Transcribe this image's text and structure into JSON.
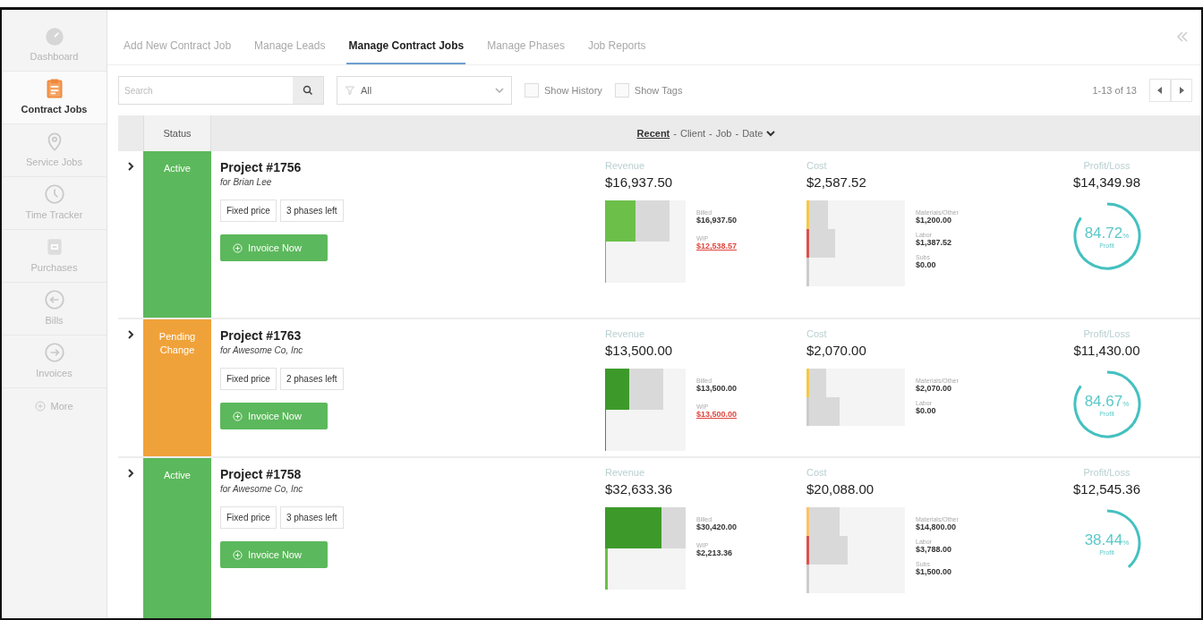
{
  "sidebar": {
    "items": [
      {
        "label": "Dashboard",
        "selected": false
      },
      {
        "label": "Contract Jobs",
        "selected": true
      },
      {
        "label": "Service Jobs",
        "selected": false
      },
      {
        "label": "Time Tracker",
        "selected": false
      },
      {
        "label": "Purchases",
        "selected": false
      },
      {
        "label": "Bills",
        "selected": false
      },
      {
        "label": "Invoices",
        "selected": false
      }
    ],
    "more": "More"
  },
  "tabs": [
    {
      "label": "Add New Contract Job",
      "selected": false
    },
    {
      "label": "Manage Leads",
      "selected": false
    },
    {
      "label": "Manage Contract Jobs",
      "selected": true
    },
    {
      "label": "Manage Phases",
      "selected": false
    },
    {
      "label": "Job Reports",
      "selected": false
    }
  ],
  "toolbar": {
    "search": {
      "placeholder": "Search"
    },
    "filter": {
      "value": "All"
    },
    "checkboxes": [
      {
        "label": "Show History",
        "checked": false
      },
      {
        "label": "Show Tags",
        "checked": false
      }
    ],
    "pager": "1-13 of 13"
  },
  "table": {
    "status_header": "Status",
    "separator": "-",
    "sort_options": [
      {
        "label": "Recent",
        "selected": true
      },
      {
        "label": "Client",
        "selected": false
      },
      {
        "label": "Job",
        "selected": false
      },
      {
        "label": "Date",
        "selected": false
      }
    ],
    "rows": [
      {
        "status": "Active",
        "kind": "active",
        "title": "Project #1756",
        "client": "for Brian Lee",
        "tags": [
          "Fixed price",
          "3 phases left"
        ],
        "button": "Invoice Now",
        "revenue": {
          "label": "Revenue",
          "amount": "$16,937.50",
          "items": [
            {
              "label": "Billed",
              "amount": "$16,937.50",
              "negative": false,
              "level": 0.38,
              "color": "#6cc04a"
            },
            {
              "label": "WIP",
              "amount": "$12,538.57",
              "negative": true,
              "level": 0,
              "color": "#6cc04a"
            }
          ]
        },
        "cost": {
          "label": "Cost",
          "amount": "$2,587.52",
          "items": [
            {
              "label": "Materials/Other",
              "amount": "$1,200.00",
              "level": 0.2,
              "color": "#f2c94c"
            },
            {
              "label": "Labor",
              "amount": "$1,387.52",
              "level": 0.27,
              "color": "#d9534f"
            },
            {
              "label": "Subs",
              "amount": "$0.00",
              "level": 0,
              "color": "#cccccc"
            }
          ]
        },
        "profit": {
          "label": "Profit/Loss",
          "amount": "$14,349.98",
          "value": "84.72",
          "unit": "%",
          "caption": "Profit"
        }
      },
      {
        "status": "Pending Change",
        "kind": "pending",
        "title": "Project #1763",
        "client": "for Awesome Co, Inc",
        "tags": [
          "Fixed price",
          "2 phases left"
        ],
        "button": "Invoice Now",
        "revenue": {
          "label": "Revenue",
          "amount": "$13,500.00",
          "items": [
            {
              "label": "Billed",
              "amount": "$13,500.00",
              "negative": false,
              "level": 0.3,
              "color": "#3d9a2a"
            },
            {
              "label": "WIP",
              "amount": "$13,500.00",
              "negative": true,
              "level": 0,
              "color": "#3d9a2a"
            }
          ]
        },
        "cost": {
          "label": "Cost",
          "amount": "$2,070.00",
          "items": [
            {
              "label": "Materials/Other",
              "amount": "$2,070.00",
              "level": 0.18,
              "color": "#f2c94c"
            },
            {
              "label": "Labor",
              "amount": "$0.00",
              "level": 0.32,
              "color": "#cccccc"
            }
          ]
        },
        "profit": {
          "label": "Profit/Loss",
          "amount": "$11,430.00",
          "value": "84.67",
          "unit": "%",
          "caption": "Profit"
        }
      },
      {
        "status": "Active",
        "kind": "active",
        "title": "Project #1758",
        "client": "for Awesome Co, Inc",
        "tags": [
          "Fixed price",
          "3 phases left"
        ],
        "button": "Invoice Now",
        "revenue": {
          "label": "Revenue",
          "amount": "$32,633.36",
          "items": [
            {
              "label": "Billed",
              "amount": "$30,420.00",
              "negative": false,
              "level": 0.7,
              "color": "#3d9a2a"
            },
            {
              "label": "WIP",
              "amount": "$2,213.36",
              "negative": false,
              "level": 0.03,
              "color": "#6cc04a"
            }
          ]
        },
        "cost": {
          "label": "Cost",
          "amount": "$20,088.00",
          "items": [
            {
              "label": "Materials/Other",
              "amount": "$14,800.00",
              "level": 0.32,
              "color": "#f9c36a"
            },
            {
              "label": "Labor",
              "amount": "$3,788.00",
              "level": 0.4,
              "color": "#d9534f"
            },
            {
              "label": "Subs",
              "amount": "$1,500.00",
              "level": 0,
              "color": "#cccccc"
            }
          ]
        },
        "profit": {
          "label": "Profit/Loss",
          "amount": "$12,545.36",
          "value": "38.44",
          "unit": "%",
          "caption": "Profit"
        }
      }
    ]
  }
}
